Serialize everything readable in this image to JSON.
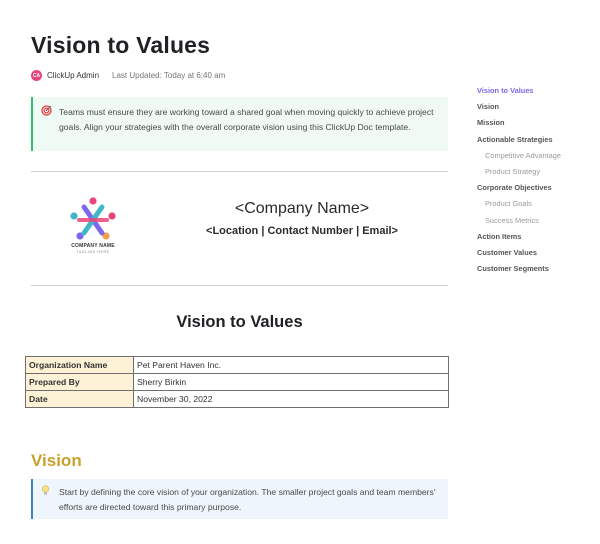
{
  "document": {
    "title": "Vision to Values",
    "author_initials": "CA",
    "author": "ClickUp Admin",
    "last_updated": "Last Updated: Today at 6:40 am",
    "intro_callout": {
      "icon": "target-icon",
      "text": "Teams must ensure they are working toward a shared goal when moving quickly to achieve project goals. Align your strategies with the overall corporate vision using this ClickUp Doc template."
    },
    "header_block": {
      "logo_name": "COMPANY NAME",
      "logo_tagline": "TAGLINE HERE",
      "company_name": "<Company Name>",
      "contact_line": "<Location | Contact Number | Email>"
    },
    "subtitle": "Vision to Values",
    "info_table": [
      {
        "label": "Organization Name",
        "value": "Pet Parent Haven Inc."
      },
      {
        "label": "Prepared By",
        "value": "Sherry Birkin"
      },
      {
        "label": "Date",
        "value": "November 30, 2022"
      }
    ],
    "vision_section": {
      "heading": "Vision",
      "callout_icon": "lightbulb-icon",
      "callout_text": "Start by defining the core vision of your organization. The smaller project goals and team members' efforts are directed toward this primary purpose."
    }
  },
  "toc": {
    "items": [
      {
        "label": "Vision to Values",
        "level": 1,
        "active": true
      },
      {
        "label": "Vision",
        "level": 1
      },
      {
        "label": "Mission",
        "level": 1
      },
      {
        "label": "Actionable Strategies",
        "level": 1
      },
      {
        "label": "Competitive Advantage",
        "level": 2
      },
      {
        "label": "Product Strategy",
        "level": 2
      },
      {
        "label": "Corporate Objectives",
        "level": 1
      },
      {
        "label": "Product Goals",
        "level": 2
      },
      {
        "label": "Success Metrics",
        "level": 2
      },
      {
        "label": "Action Items",
        "level": 1
      },
      {
        "label": "Customer Values",
        "level": 1
      },
      {
        "label": "Customer Segments",
        "level": 1
      }
    ]
  },
  "colors": {
    "accent": "#7b68ee",
    "vision_heading": "#c8a22b",
    "green_callout_border": "#2fbf71",
    "blue_callout_border": "#3b82c8",
    "table_label_bg": "#fdf1d6"
  }
}
